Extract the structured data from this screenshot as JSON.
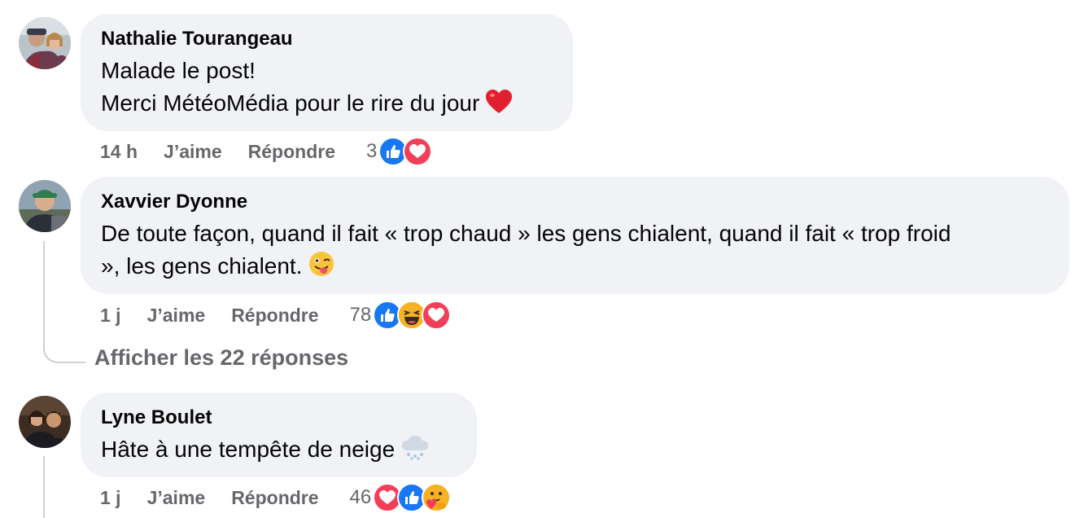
{
  "comments": [
    {
      "author": "Nathalie Tourangeau",
      "text_line1": "Malade le post!",
      "text_line2": "Merci MétéoMédia pour le rire du jour",
      "trailing_emoji": "red-heart-emoji",
      "time": "14 h",
      "like_label": "J’aime",
      "reply_label": "Répondre",
      "reaction_count": "3",
      "reactions": [
        "like",
        "love"
      ]
    },
    {
      "author": "Xavvier Dyonne",
      "text_line1": "De toute façon, quand il fait « trop chaud » les gens chialent, quand il fait « trop froid",
      "text_line2": "», les gens chialent.",
      "trailing_emoji": "winking-face-with-tongue-emoji",
      "time": "1 j",
      "like_label": "J’aime",
      "reply_label": "Répondre",
      "reaction_count": "78",
      "reactions": [
        "like",
        "haha",
        "love"
      ],
      "view_replies_label": "Afficher les 22 réponses"
    },
    {
      "author": "Lyne Boulet",
      "text_line1": "Hâte à une tempête de neige",
      "trailing_emoji": "snow-cloud-emoji",
      "time": "1 j",
      "like_label": "J’aime",
      "reply_label": "Répondre",
      "reaction_count": "46",
      "reactions": [
        "love",
        "like",
        "care"
      ]
    }
  ],
  "colors": {
    "bubble_bg": "#f0f2f5",
    "meta_text": "#65676b",
    "like_blue": "#1877f2",
    "love_red": "#f33e58",
    "haha_yellow": "#f7b125",
    "thread_line": "#ced0d4"
  }
}
